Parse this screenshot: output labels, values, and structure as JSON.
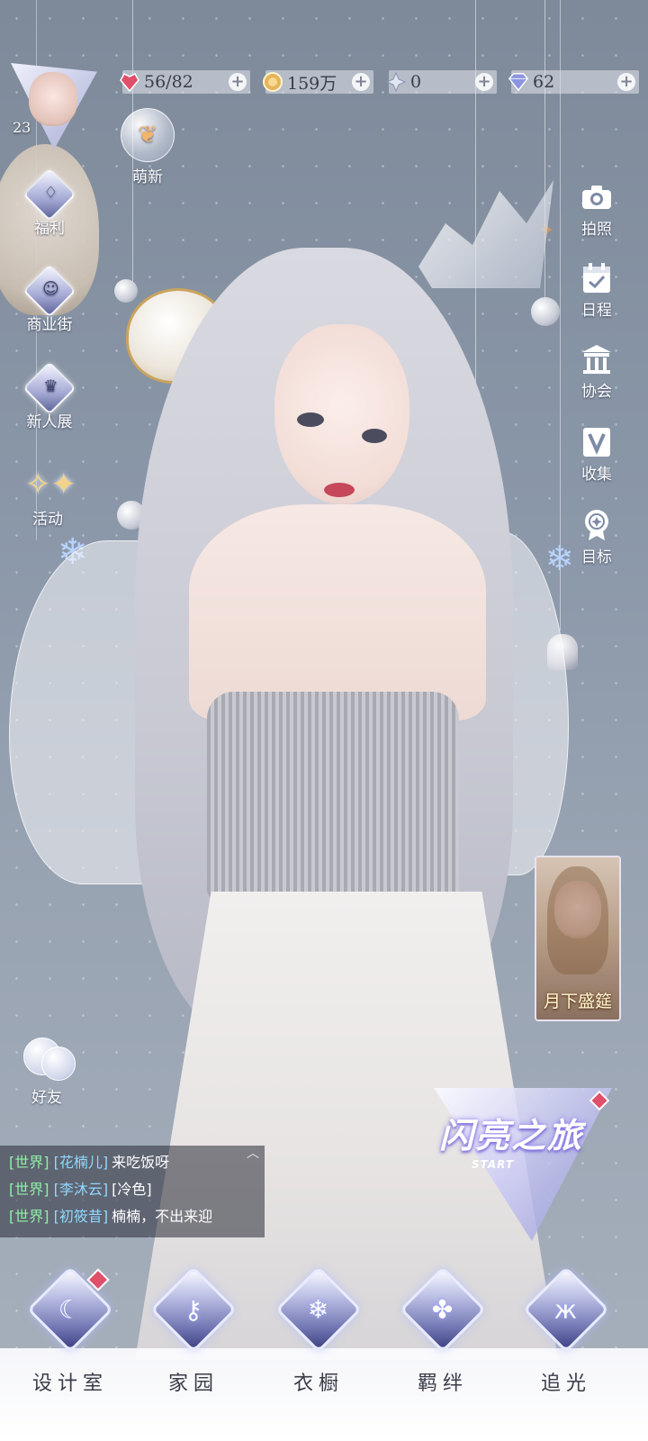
{
  "player": {
    "level": "23"
  },
  "currencies": [
    {
      "name": "stamina",
      "icon": "heart-gem-icon",
      "value": "56/82",
      "color": "#e0506a"
    },
    {
      "name": "gold",
      "icon": "gold-coin-icon",
      "value": "159万",
      "color": "#e6b45a"
    },
    {
      "name": "crystal",
      "icon": "snow-crystal-icon",
      "value": "0",
      "color": "#c9d4e8"
    },
    {
      "name": "diamond",
      "icon": "diamond-icon",
      "value": "62",
      "color": "#7a82d8"
    }
  ],
  "event_bubble": {
    "label": "萌新"
  },
  "left_menu": [
    {
      "label": "福利",
      "icon": "balloon-icon"
    },
    {
      "label": "商业街",
      "icon": "shop-bag-icon"
    },
    {
      "label": "新人展",
      "icon": "crown-icon"
    },
    {
      "label": "活动",
      "icon": "stars-icon"
    }
  ],
  "right_menu": [
    {
      "label": "拍照",
      "icon": "camera-icon"
    },
    {
      "label": "日程",
      "icon": "calendar-icon"
    },
    {
      "label": "协会",
      "icon": "guild-building-icon"
    },
    {
      "label": "收集",
      "icon": "collection-icon"
    },
    {
      "label": "目标",
      "icon": "medal-icon"
    }
  ],
  "promo_card": {
    "text": "月下盛筵"
  },
  "friends": {
    "label": "好友"
  },
  "chat": [
    {
      "channel": "[世界]",
      "user": "[花楠儿]",
      "message": "来吃饭呀"
    },
    {
      "channel": "[世界]",
      "user": "[李沐云]",
      "message": "[冷色]"
    },
    {
      "channel": "[世界]",
      "user": "[初筱昔]",
      "message": "楠楠，不出来迎"
    }
  ],
  "shine_journey": {
    "title": "闪亮之旅",
    "subtitle": "START"
  },
  "bottom_nav": [
    {
      "label": "设计室",
      "icon": "moon-icon",
      "badge": true
    },
    {
      "label": "家园",
      "icon": "key-icon",
      "badge": false
    },
    {
      "label": "衣橱",
      "icon": "snowflake-icon",
      "badge": false
    },
    {
      "label": "羁绊",
      "icon": "clover-icon",
      "badge": false
    },
    {
      "label": "追光",
      "icon": "butterfly-icon",
      "badge": false
    }
  ]
}
